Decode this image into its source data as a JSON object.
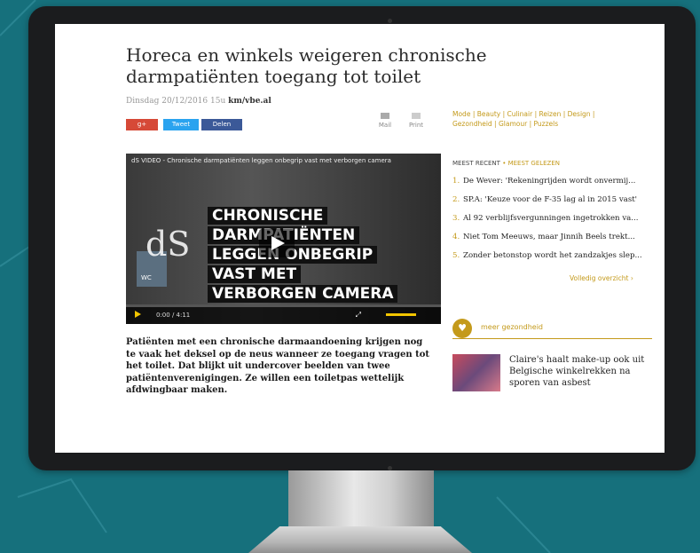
{
  "article": {
    "headline": "Horeca en winkels weigeren chronische darmpatiënten toegang tot toilet",
    "byline_date": "Dinsdag 20/12/2016 15u",
    "byline_author": "km/vbe.al",
    "share_gplus": "g+",
    "share_tweet": "Tweet",
    "share_facebook": "Delen",
    "mail_label": "Mail",
    "print_label": "Print",
    "lead": "Patiënten met een chronische darmaandoening krijgen nog te vaak het deksel op de neus wanneer ze toegang vragen tot het toilet. Dat blijkt uit undercover beelden van twee patiëntenverenigingen. Ze willen een toiletpas wettelijk afdwingbaar maken."
  },
  "video": {
    "title": "dS VIDEO - Chronische darmpatiënten leggen onbegrip vast met verborgen camera",
    "logo": "dS",
    "wc_label": "WC",
    "lines": [
      "CHRONISCHE",
      "DARMPATIËNTEN",
      "LEGGEN ONBEGRIP",
      "VAST MET",
      "VERBORGEN CAMERA"
    ],
    "time": "0:00 / 4:11",
    "progress": 0
  },
  "sidebar": {
    "categories": "Mode | Beauty | Culinair | Reizen | Design | Gezondheid | Glamour | Puzzels",
    "tab_recent": "MEEST RECENT",
    "tab_separator": "•",
    "tab_read": "MEEST GELEZEN",
    "items": [
      {
        "num": "1.",
        "text": "De Wever: 'Rekeningrijden wordt onvermij..."
      },
      {
        "num": "2.",
        "text": "SP.A: 'Keuze voor de F-35 lag al in 2015 vast'"
      },
      {
        "num": "3.",
        "text": "Al 92 verblijfsvergunningen ingetrokken va..."
      },
      {
        "num": "4.",
        "text": "Niet Tom Meeuws, maar Jinnih Beels trekt..."
      },
      {
        "num": "5.",
        "text": "Zonder betonstop wordt het zandzakjes slep..."
      }
    ],
    "full_overview": "Volledig overzicht",
    "health_title": "meer gezondheid",
    "promo_text": "Claire's haalt make-up ook uit Belgische winkelrekken na sporen van asbest",
    "accent": "#c49a1b"
  }
}
